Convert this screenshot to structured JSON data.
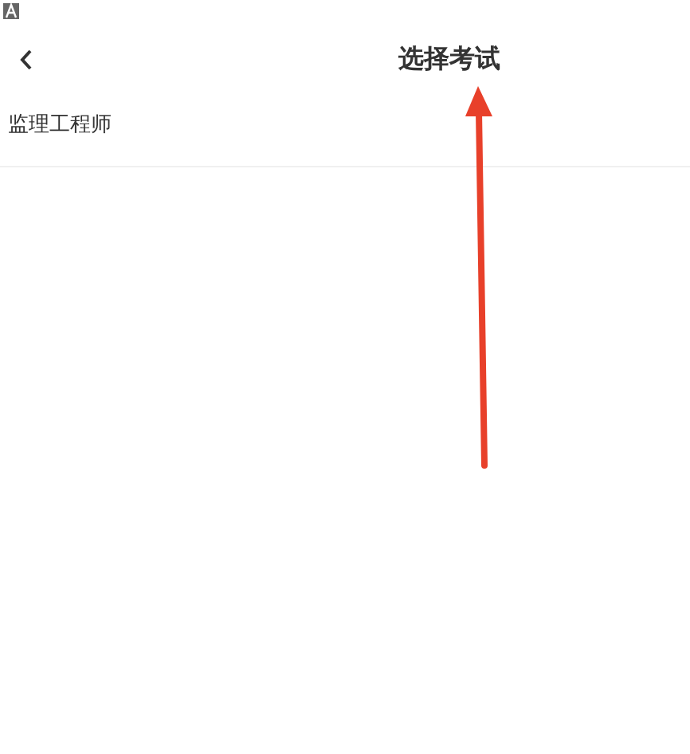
{
  "header": {
    "title": "选择考试"
  },
  "exams": [
    {
      "name": "监理工程师"
    }
  ]
}
